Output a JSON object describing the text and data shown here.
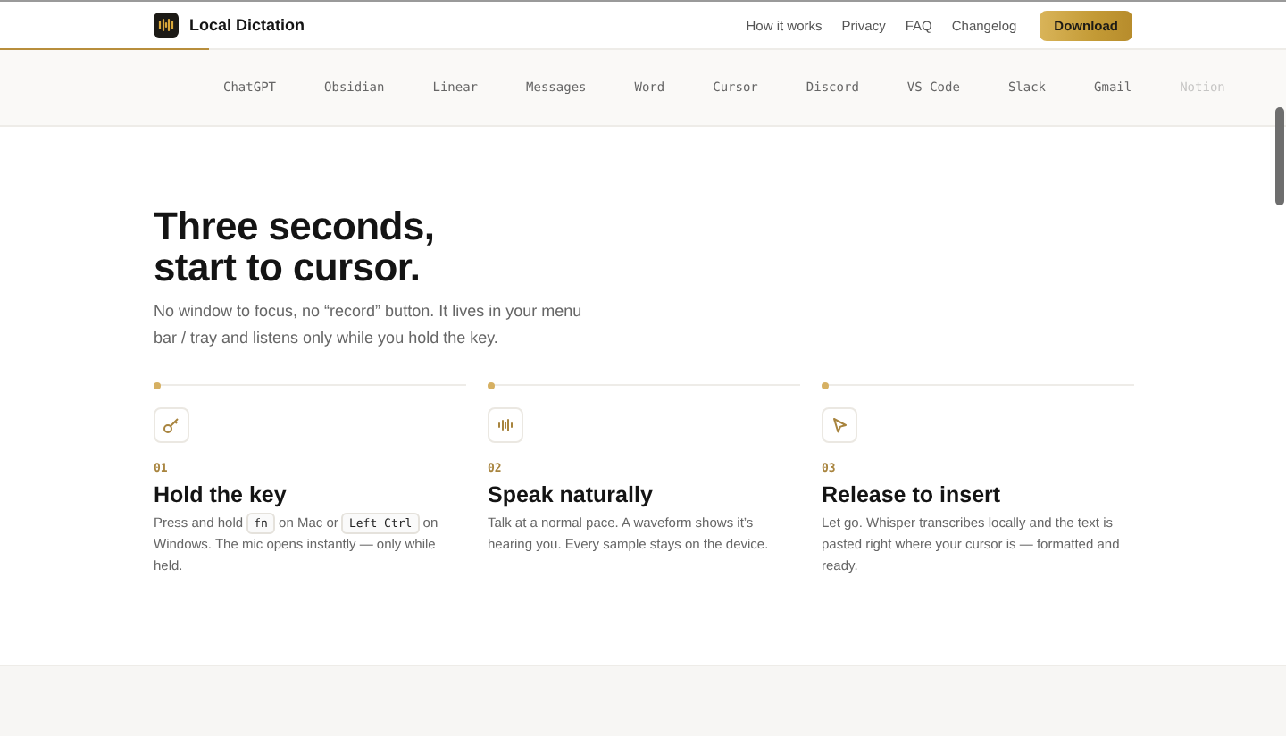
{
  "nav": {
    "brand": "Local Dictation",
    "links": [
      "How it works",
      "Privacy",
      "FAQ",
      "Changelog"
    ],
    "cta": "Download"
  },
  "scroll_progress": {
    "level": 0.163
  },
  "apps": [
    "ChatGPT",
    "Obsidian",
    "Linear",
    "Messages",
    "Word",
    "Cursor",
    "Discord",
    "VS Code",
    "Slack",
    "Gmail",
    "Notion"
  ],
  "hero": {
    "title_lines": [
      "Three seconds,",
      "start to cursor."
    ],
    "lead": "No window to focus, no “record” button. It lives in your menu bar / tray and listens only while you hold the key."
  },
  "steps": [
    {
      "kind": "key",
      "number": "01",
      "title": "Hold the key",
      "body": [
        {
          "kind": "text",
          "text": "Press and hold "
        },
        {
          "kind": "key",
          "text": "fn"
        },
        {
          "kind": "text",
          "text": " on Mac or "
        },
        {
          "kind": "key",
          "text": "Left Ctrl"
        },
        {
          "kind": "text",
          "text": " on Windows. The mic opens instantly — only while held."
        }
      ]
    },
    {
      "kind": "wave",
      "number": "02",
      "title": "Speak naturally",
      "body": [
        {
          "kind": "text",
          "text": "Talk at a normal pace. A waveform shows it’s hearing you. Every sample stays on the device."
        }
      ]
    },
    {
      "kind": "cursor",
      "number": "03",
      "title": "Release to insert",
      "body": [
        {
          "kind": "text",
          "text": "Let go. Whisper transcribes locally and the text is pasted right where your cursor is — formatted and ready."
        }
      ]
    }
  ]
}
